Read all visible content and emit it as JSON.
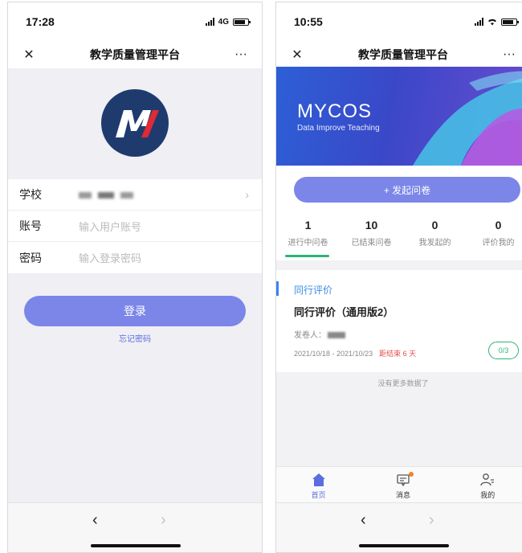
{
  "left": {
    "status": {
      "time": "17:28",
      "network": "4G"
    },
    "nav": {
      "title": "教学质量管理平台",
      "close": "✕",
      "more": "···"
    },
    "form": {
      "school": {
        "label": "学校"
      },
      "account": {
        "label": "账号",
        "placeholder": "输入用户账号"
      },
      "password": {
        "label": "密码",
        "placeholder": "输入登录密码"
      }
    },
    "login_label": "登录",
    "forgot_label": "忘记密码",
    "browser": {
      "back": "‹",
      "forward": "›"
    }
  },
  "right": {
    "status": {
      "time": "10:55"
    },
    "nav": {
      "title": "教学质量管理平台",
      "close": "✕",
      "more": "···"
    },
    "banner": {
      "title": "MYCOS",
      "subtitle": "Data  Improve Teaching"
    },
    "launch_label": "+ 发起问卷",
    "stats": [
      {
        "num": "1",
        "label": "进行中问卷"
      },
      {
        "num": "10",
        "label": "已结束问卷"
      },
      {
        "num": "0",
        "label": "我发起的"
      },
      {
        "num": "0",
        "label": "评价我的"
      }
    ],
    "task": {
      "category": "同行评价",
      "title": "同行评价（通用版2）",
      "issuer_label": "发卷人：",
      "dates": "2021/10/18 - 2021/10/23",
      "deadline": "距结束 6 天",
      "progress": "0/3"
    },
    "no_more": "没有更多数据了",
    "tabbar": [
      {
        "label": "首页",
        "icon": "home-icon"
      },
      {
        "label": "消息",
        "icon": "message-icon"
      },
      {
        "label": "我的",
        "icon": "profile-icon"
      }
    ],
    "browser": {
      "back": "‹",
      "forward": "›"
    }
  }
}
